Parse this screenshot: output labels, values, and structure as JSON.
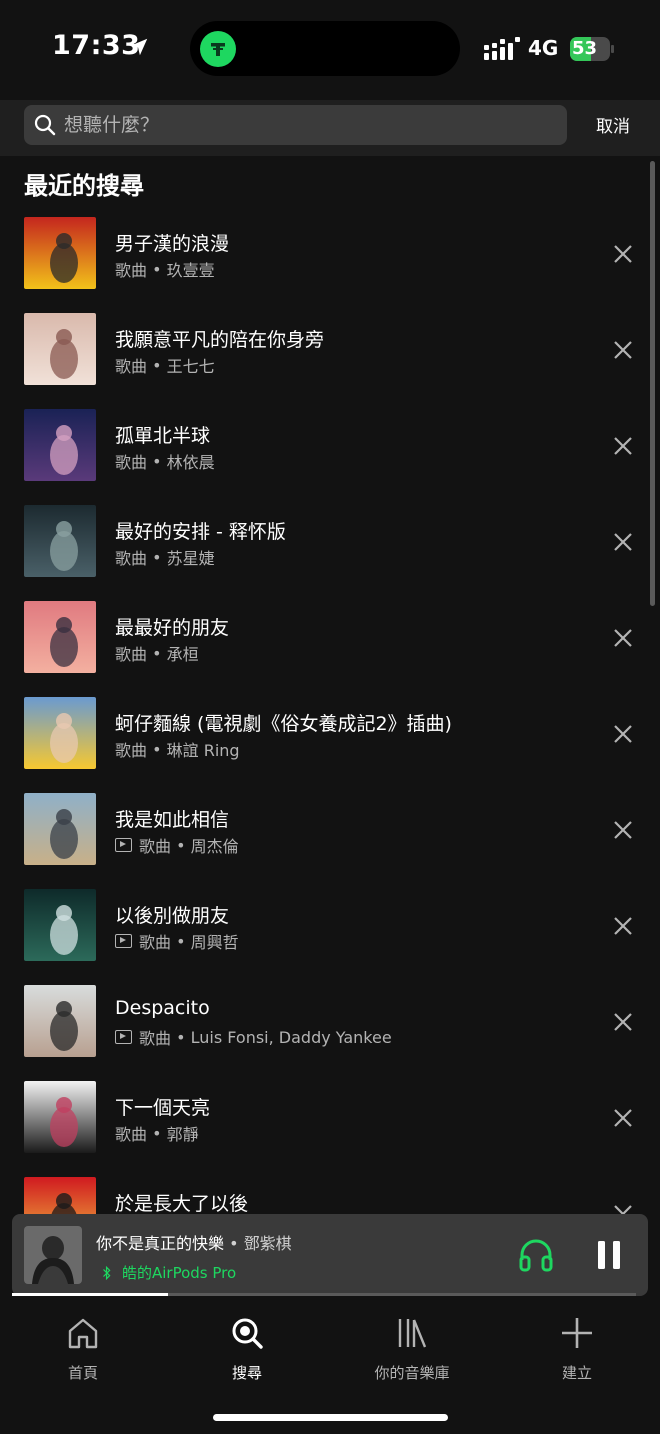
{
  "status_bar": {
    "time": "17:33",
    "network": "4G",
    "battery": "53",
    "battery_level": 0.53,
    "island_app_icon": "tether-icon"
  },
  "search": {
    "placeholder": "想聽什麼？",
    "cancel_label": "取消"
  },
  "recent": {
    "title": "最近的搜尋",
    "items": [
      {
        "title": "男子漢的浪漫",
        "type": "歌曲",
        "artist": "玖壹壹",
        "video": false,
        "art_colors": [
          "#c4261e",
          "#f2c21a",
          "#2a2a2a"
        ]
      },
      {
        "title": "我願意平凡的陪在你身旁",
        "type": "歌曲",
        "artist": "王七七",
        "video": false,
        "art_colors": [
          "#d9b9ac",
          "#f1e1d8",
          "#8a5a52"
        ]
      },
      {
        "title": "孤單北半球",
        "type": "歌曲",
        "artist": "林依晨",
        "video": false,
        "art_colors": [
          "#1a2255",
          "#5a3a7a",
          "#d4a0c0"
        ]
      },
      {
        "title": "最好的安排 - 释怀版",
        "type": "歌曲",
        "artist": "苏星婕",
        "video": false,
        "art_colors": [
          "#1c2a30",
          "#4a6068",
          "#8aa0a0"
        ]
      },
      {
        "title": "最最好的朋友",
        "type": "歌曲",
        "artist": "承桓",
        "video": false,
        "art_colors": [
          "#e07a80",
          "#f3b0a0",
          "#3a3040"
        ]
      },
      {
        "title": "蚵仔麵線 (電視劇《俗女養成記2》插曲)",
        "type": "歌曲",
        "artist": "琳誼 Ring",
        "video": false,
        "art_colors": [
          "#6a9ad0",
          "#f7c830",
          "#e8c8b0"
        ]
      },
      {
        "title": "我是如此相信",
        "type": "歌曲",
        "artist": "周杰倫",
        "video": true,
        "art_colors": [
          "#8fb0c8",
          "#c8b088",
          "#3a4048"
        ]
      },
      {
        "title": "以後別做朋友",
        "type": "歌曲",
        "artist": "周興哲",
        "video": true,
        "art_colors": [
          "#0e2a2a",
          "#2c6a5a",
          "#cfe0e0"
        ]
      },
      {
        "title": "Despacito",
        "type": "歌曲",
        "artist": "Luis Fonsi, Daddy Yankee",
        "video": true,
        "art_colors": [
          "#d8dcdc",
          "#b8a090",
          "#2a2a2a"
        ]
      },
      {
        "title": "下一個天亮",
        "type": "歌曲",
        "artist": "郭靜",
        "video": false,
        "art_colors": [
          "#f2f2f2",
          "#1a1a1a",
          "#c04060"
        ]
      },
      {
        "title": "於是長大了以後",
        "type": "",
        "artist": "",
        "video": false,
        "art_colors": [
          "#d01a20",
          "#f2c040",
          "#1a1a1a"
        ]
      }
    ]
  },
  "player": {
    "title": "你不是真正的快樂",
    "separator": " • ",
    "artist": "鄧紫棋",
    "device": "皓的AirPods Pro",
    "progress": 0.25,
    "accent": "#1ed760"
  },
  "nav": {
    "items": [
      {
        "label": "首頁",
        "icon": "home-icon",
        "active": false
      },
      {
        "label": "搜尋",
        "icon": "search-icon",
        "active": true
      },
      {
        "label": "你的音樂庫",
        "icon": "library-icon",
        "active": false
      },
      {
        "label": "建立",
        "icon": "plus-icon",
        "active": false
      }
    ]
  }
}
